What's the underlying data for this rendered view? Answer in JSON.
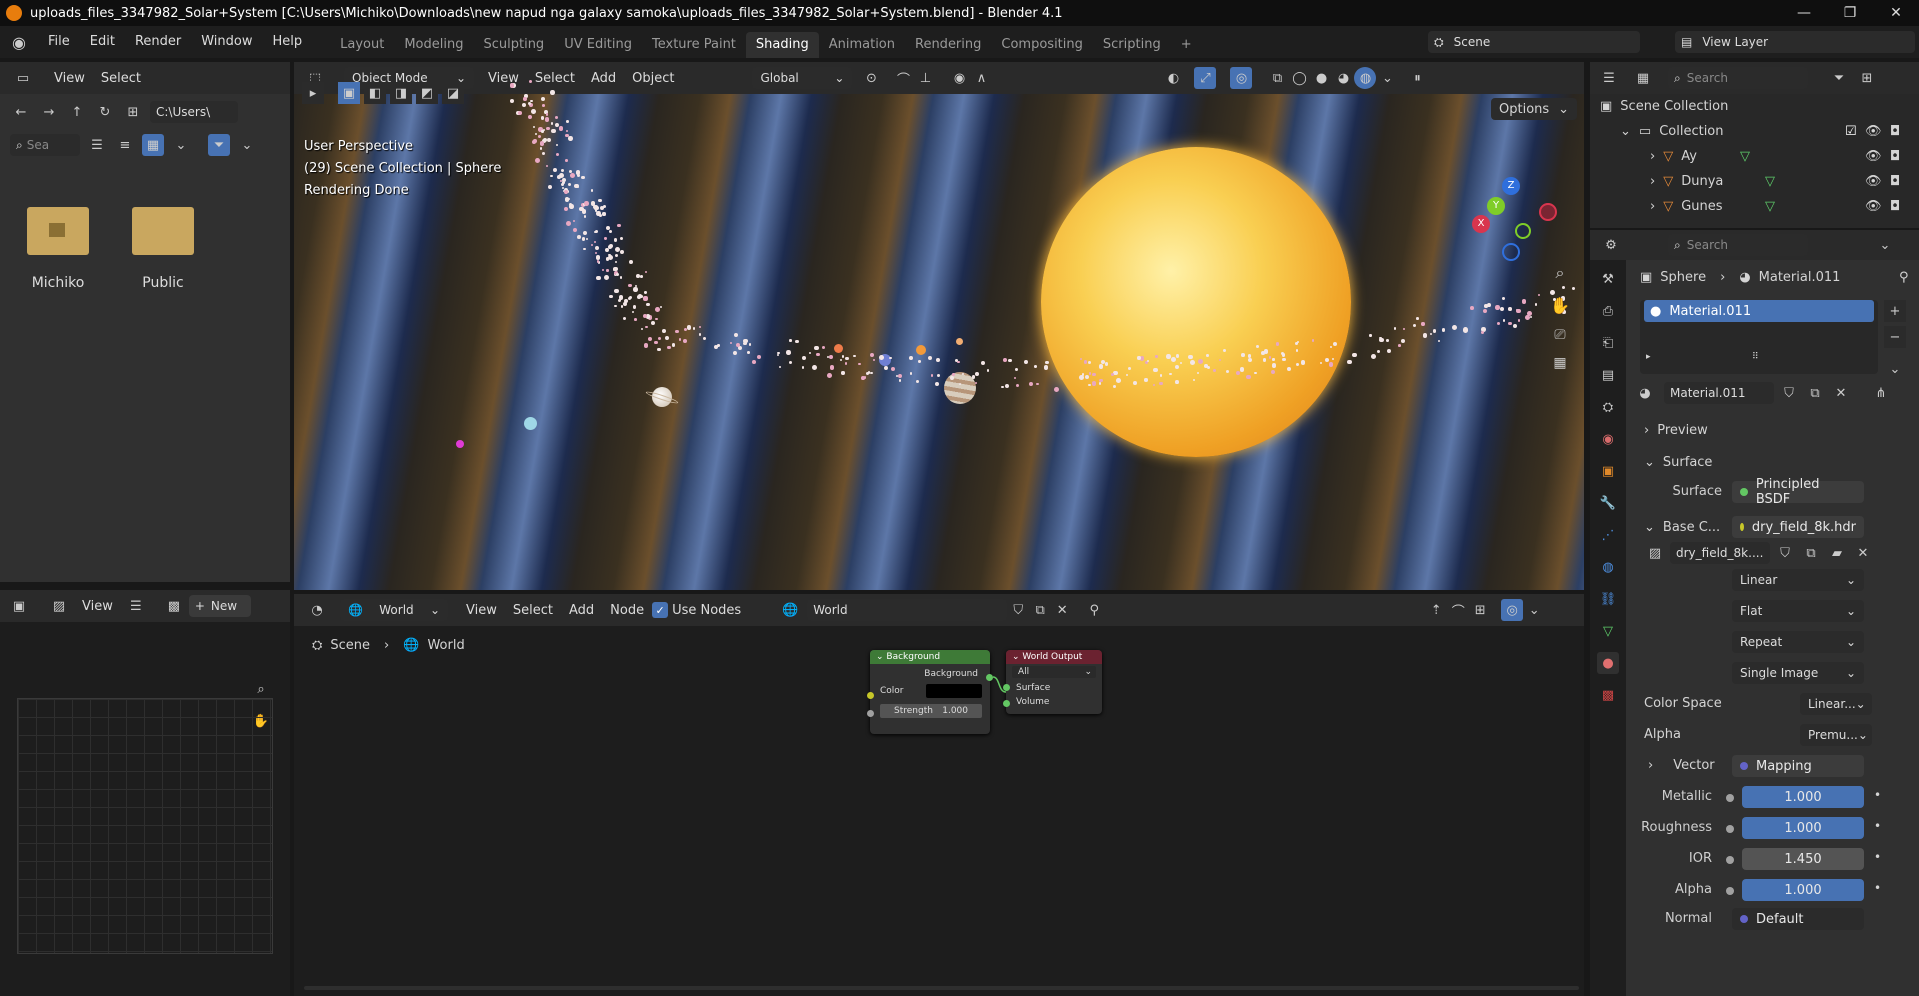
{
  "window": {
    "title": "uploads_files_3347982_Solar+System [C:\\Users\\Michiko\\Downloads\\new napud nga galaxy samoka\\uploads_files_3347982_Solar+System.blend] - Blender 4.1",
    "minimize": "—",
    "maximize": "❐",
    "close": "✕"
  },
  "menu": [
    "File",
    "Edit",
    "Render",
    "Window",
    "Help"
  ],
  "workspaces": [
    "Layout",
    "Modeling",
    "Sculpting",
    "UV Editing",
    "Texture Paint",
    "Shading",
    "Animation",
    "Rendering",
    "Compositing",
    "Scripting"
  ],
  "workspace_add": "+",
  "scene_name": "Scene",
  "view_layer": "View Layer",
  "file_browser": {
    "menu": [
      "View",
      "Select"
    ],
    "path": "C:\\Users\\",
    "search_placeholder": "Sea",
    "items": [
      "Michiko",
      "Public"
    ]
  },
  "image_editor": {
    "view": "View",
    "new": "New"
  },
  "viewport": {
    "mode": "Object Mode",
    "menu": [
      "View",
      "Select",
      "Add",
      "Object"
    ],
    "transform": "Global",
    "options": "Options",
    "overlay_lines": [
      "User Perspective",
      "(29) Scene Collection | Sphere",
      "Rendering Done"
    ],
    "axis": {
      "x": "X",
      "y": "Y",
      "z": "Z"
    }
  },
  "node_editor": {
    "type": "World",
    "menu": [
      "View",
      "Select",
      "Add",
      "Node"
    ],
    "use_nodes": "Use Nodes",
    "datablock": "World",
    "breadcrumb": [
      "Scene",
      "World"
    ],
    "background_node": {
      "title": "Background",
      "output": "Background",
      "color": "Color",
      "strength_label": "Strength",
      "strength": "1.000"
    },
    "output_node": {
      "title": "World Output",
      "target": "All",
      "surface": "Surface",
      "volume": "Volume"
    }
  },
  "outliner": {
    "search": "Search",
    "root": "Scene Collection",
    "collection": "Collection",
    "items": [
      "Ay",
      "Dunya",
      "Gunes"
    ]
  },
  "properties": {
    "search": "Search",
    "breadcrumb_object": "Sphere",
    "breadcrumb_material": "Material.011",
    "slot": "Material.011",
    "material": "Material.011",
    "preview": "Preview",
    "surface_header": "Surface",
    "surface_label": "Surface",
    "surface_value": "Principled BSDF",
    "base_color_label": "Base C...",
    "base_color_value": "dry_field_8k.hdr",
    "image_name": "dry_field_8k....",
    "interpolation": "Linear",
    "projection": "Flat",
    "extension": "Repeat",
    "source": "Single Image",
    "color_space_label": "Color Space",
    "color_space_value": "Linear...",
    "alpha_label": "Alpha",
    "alpha_value": "Premu...",
    "vector_label": "Vector",
    "vector_value": "Mapping",
    "metallic_label": "Metallic",
    "metallic": "1.000",
    "roughness_label": "Roughness",
    "roughness": "1.000",
    "ior_label": "IOR",
    "ior": "1.450",
    "alpha2_label": "Alpha",
    "alpha2": "1.000",
    "normal_label": "Normal",
    "normal": "Default"
  },
  "colors": {
    "accent": "#4772b3",
    "header": "#2a2a2a",
    "panel": "#303030",
    "sun": "#f7b531",
    "socket_green": "#63c763",
    "socket_yellow": "#c7c729",
    "socket_blue": "#6363c7"
  }
}
